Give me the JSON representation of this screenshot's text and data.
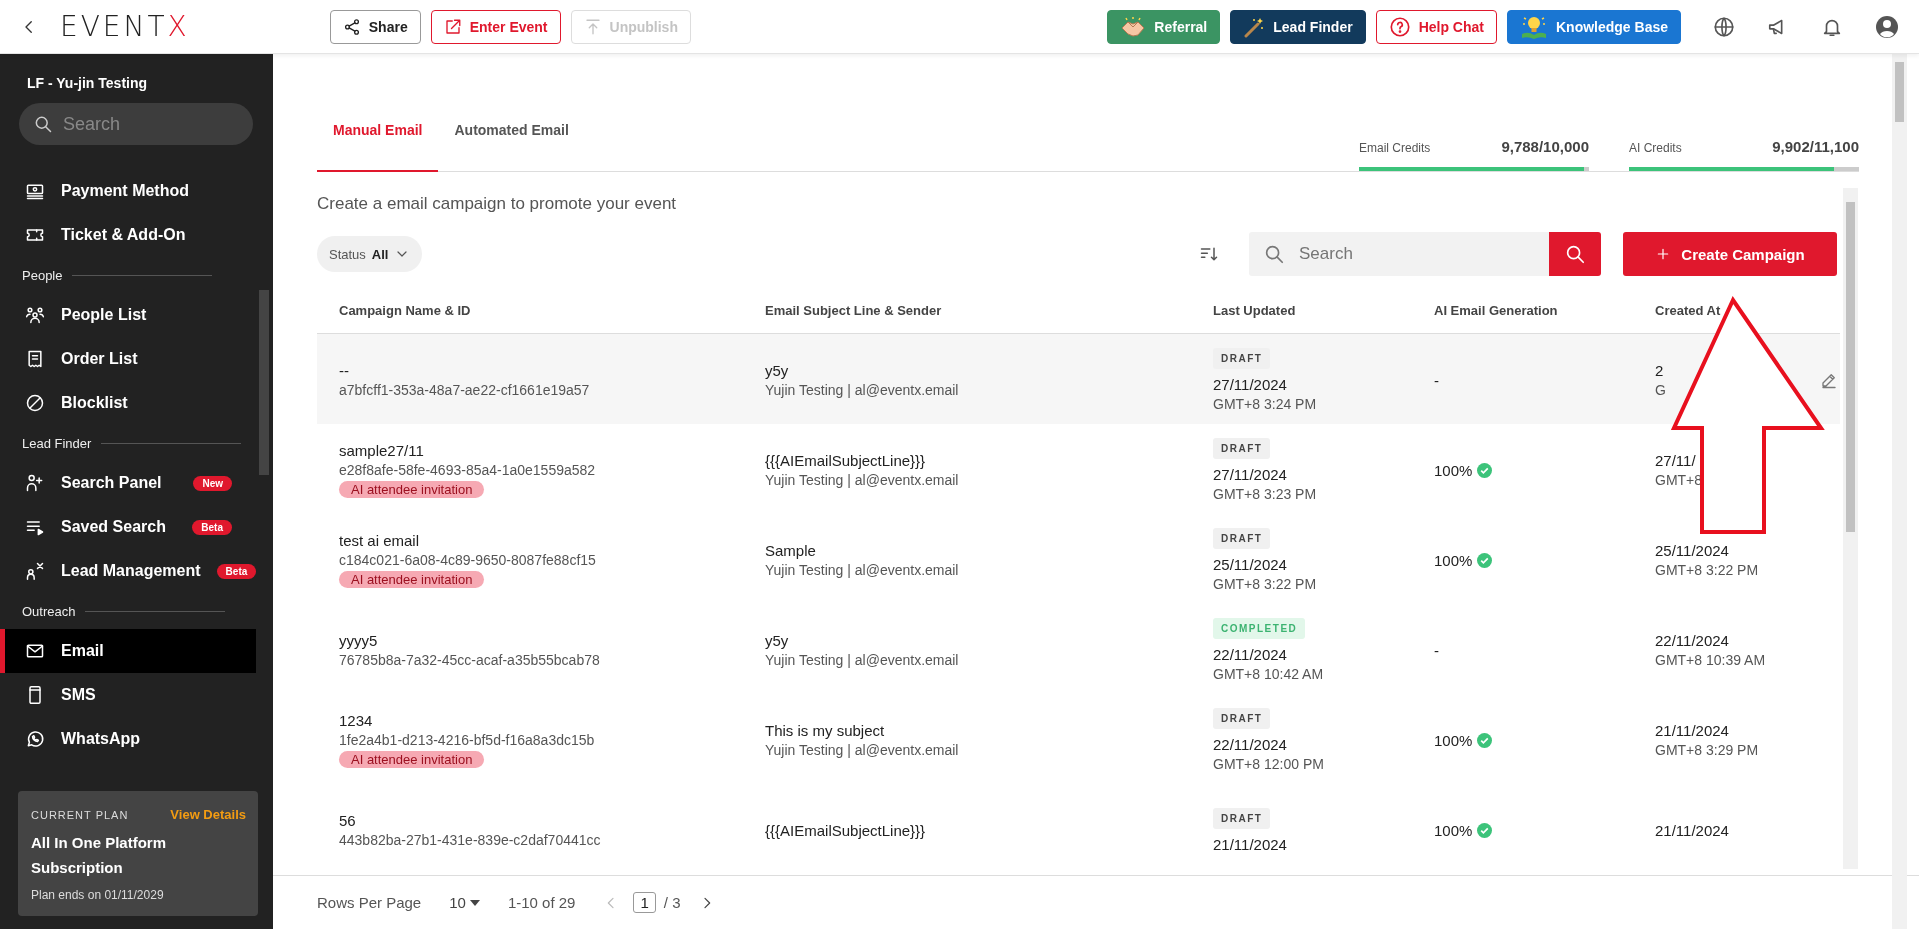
{
  "topbar": {
    "logo": {
      "text": "EVENT",
      "accent": "X"
    },
    "left_buttons": [
      {
        "label": "Share",
        "kind": "share",
        "disabled": false
      },
      {
        "label": "Enter Event",
        "kind": "enter",
        "disabled": false
      },
      {
        "label": "Unpublish",
        "kind": "unpublish",
        "disabled": true
      }
    ],
    "right_buttons": [
      {
        "label": "Referral",
        "kind": "referral"
      },
      {
        "label": "Lead Finder",
        "kind": "lead"
      },
      {
        "label": "Help Chat",
        "kind": "help"
      },
      {
        "label": "Knowledge Base",
        "kind": "kb"
      }
    ]
  },
  "sidebar": {
    "event_name": "LF - Yu-jin Testing",
    "search": {
      "placeholder": "Search"
    },
    "sections": [
      {
        "items": [
          {
            "label": "Payment Method",
            "kind": "payment",
            "selected": false
          },
          {
            "label": "Ticket & Add-On",
            "kind": "ticket",
            "selected": false
          }
        ]
      },
      {
        "title": "People",
        "items": [
          {
            "label": "People List",
            "kind": "people",
            "selected": false
          },
          {
            "label": "Order List",
            "kind": "order",
            "selected": false
          },
          {
            "label": "Blocklist",
            "kind": "block",
            "selected": false
          }
        ]
      },
      {
        "title": "Lead Finder",
        "items": [
          {
            "label": "Search Panel",
            "kind": "search-panel",
            "badge": "New",
            "selected": false
          },
          {
            "label": "Saved Search",
            "kind": "saved",
            "badge": "Beta",
            "selected": false
          },
          {
            "label": "Lead Management",
            "kind": "lead-mgmt",
            "badge": "Beta",
            "selected": false
          }
        ]
      },
      {
        "title": "Outreach",
        "items": [
          {
            "label": "Email",
            "kind": "email",
            "selected": true
          },
          {
            "label": "SMS",
            "kind": "sms",
            "selected": false
          },
          {
            "label": "WhatsApp",
            "kind": "whatsapp",
            "selected": false
          }
        ]
      }
    ],
    "plan": {
      "label": "CURRENT PLAN",
      "link": "View Details",
      "name": "All In One Platform Subscription",
      "ends": "Plan ends on 01/11/2029"
    }
  },
  "main": {
    "tabs": [
      {
        "label": "Manual Email",
        "selected": true
      },
      {
        "label": "Automated Email",
        "selected": false
      }
    ],
    "credits": [
      {
        "label": "Email Credits",
        "value": "9,788/10,000",
        "level": 0.98
      },
      {
        "label": "AI Credits",
        "value": "9,902/11,100",
        "level": 0.89
      }
    ],
    "description": "Create a email campaign to promote your event",
    "status_filter": {
      "label": "Status",
      "value": "All"
    },
    "search": {
      "placeholder": "Search"
    },
    "create_button": "Create Campaign",
    "table": {
      "columns": [
        "Campaign Name & ID",
        "Email Subject Line & Sender",
        "Last Updated",
        "AI Email Generation",
        "Created At"
      ],
      "rows": [
        {
          "name": "--",
          "id": "a7bfcff1-353a-48a7-ae22-cf1661e19a57",
          "subject": "y5y",
          "sender": "Yujin Testing | al@eventx.email",
          "status": {
            "label": "DRAFT",
            "kind": "draft"
          },
          "date": "27/11/2024",
          "time": "GMT+8 3:24 PM",
          "ai": "-",
          "ai_complete": false,
          "created_date": "2",
          "created_time": "G",
          "hovered": true
        },
        {
          "name": "sample27/11",
          "id": "e28f8afe-58fe-4693-85a4-1a0e1559a582",
          "tag": "AI attendee invitation",
          "subject": "{{{AIEmailSubjectLine}}}",
          "sender": "Yujin Testing | al@eventx.email",
          "status": {
            "label": "DRAFT",
            "kind": "draft"
          },
          "date": "27/11/2024",
          "time": "GMT+8 3:23 PM",
          "ai": "100%",
          "ai_complete": true,
          "created_date": "27/11/",
          "created_time": "GMT+8",
          "hovered": false
        },
        {
          "name": "test ai email",
          "id": "c184c021-6a08-4c89-9650-8087fe88cf15",
          "tag": "AI attendee invitation",
          "subject": "Sample",
          "sender": "Yujin Testing | al@eventx.email",
          "status": {
            "label": "DRAFT",
            "kind": "draft"
          },
          "date": "25/11/2024",
          "time": "GMT+8 3:22 PM",
          "ai": "100%",
          "ai_complete": true,
          "created_date": "25/11/2024",
          "created_time": "GMT+8 3:22 PM",
          "hovered": false
        },
        {
          "name": "yyyy5",
          "id": "76785b8a-7a32-45cc-acaf-a35b55bcab78",
          "subject": "y5y",
          "sender": "Yujin Testing | al@eventx.email",
          "status": {
            "label": "COMPLETED",
            "kind": "completed"
          },
          "date": "22/11/2024",
          "time": "GMT+8 10:42 AM",
          "ai": "-",
          "ai_complete": false,
          "created_date": "22/11/2024",
          "created_time": "GMT+8 10:39 AM",
          "hovered": false
        },
        {
          "name": "1234",
          "id": "1fe2a4b1-d213-4216-bf5d-f16a8a3dc15b",
          "tag": "AI attendee invitation",
          "subject": "This is my subject",
          "sender": "Yujin Testing | al@eventx.email",
          "status": {
            "label": "DRAFT",
            "kind": "draft"
          },
          "date": "22/11/2024",
          "time": "GMT+8 12:00 PM",
          "ai": "100%",
          "ai_complete": true,
          "created_date": "21/11/2024",
          "created_time": "GMT+8 3:29 PM",
          "hovered": false
        },
        {
          "name": "56",
          "id": "443b82ba-27b1-431e-839e-c2daf70441cc",
          "subject": "{{{AIEmailSubjectLine}}}",
          "status": {
            "label": "DRAFT",
            "kind": "draft"
          },
          "date": "21/11/2024",
          "ai": "100%",
          "ai_complete": true,
          "created_date": "21/11/2024",
          "hovered": false
        }
      ]
    },
    "pagination": {
      "rows_label": "Rows Per Page",
      "rows_value": "10",
      "range": "1-10 of 29",
      "page": "1",
      "total": "/ 3"
    }
  }
}
